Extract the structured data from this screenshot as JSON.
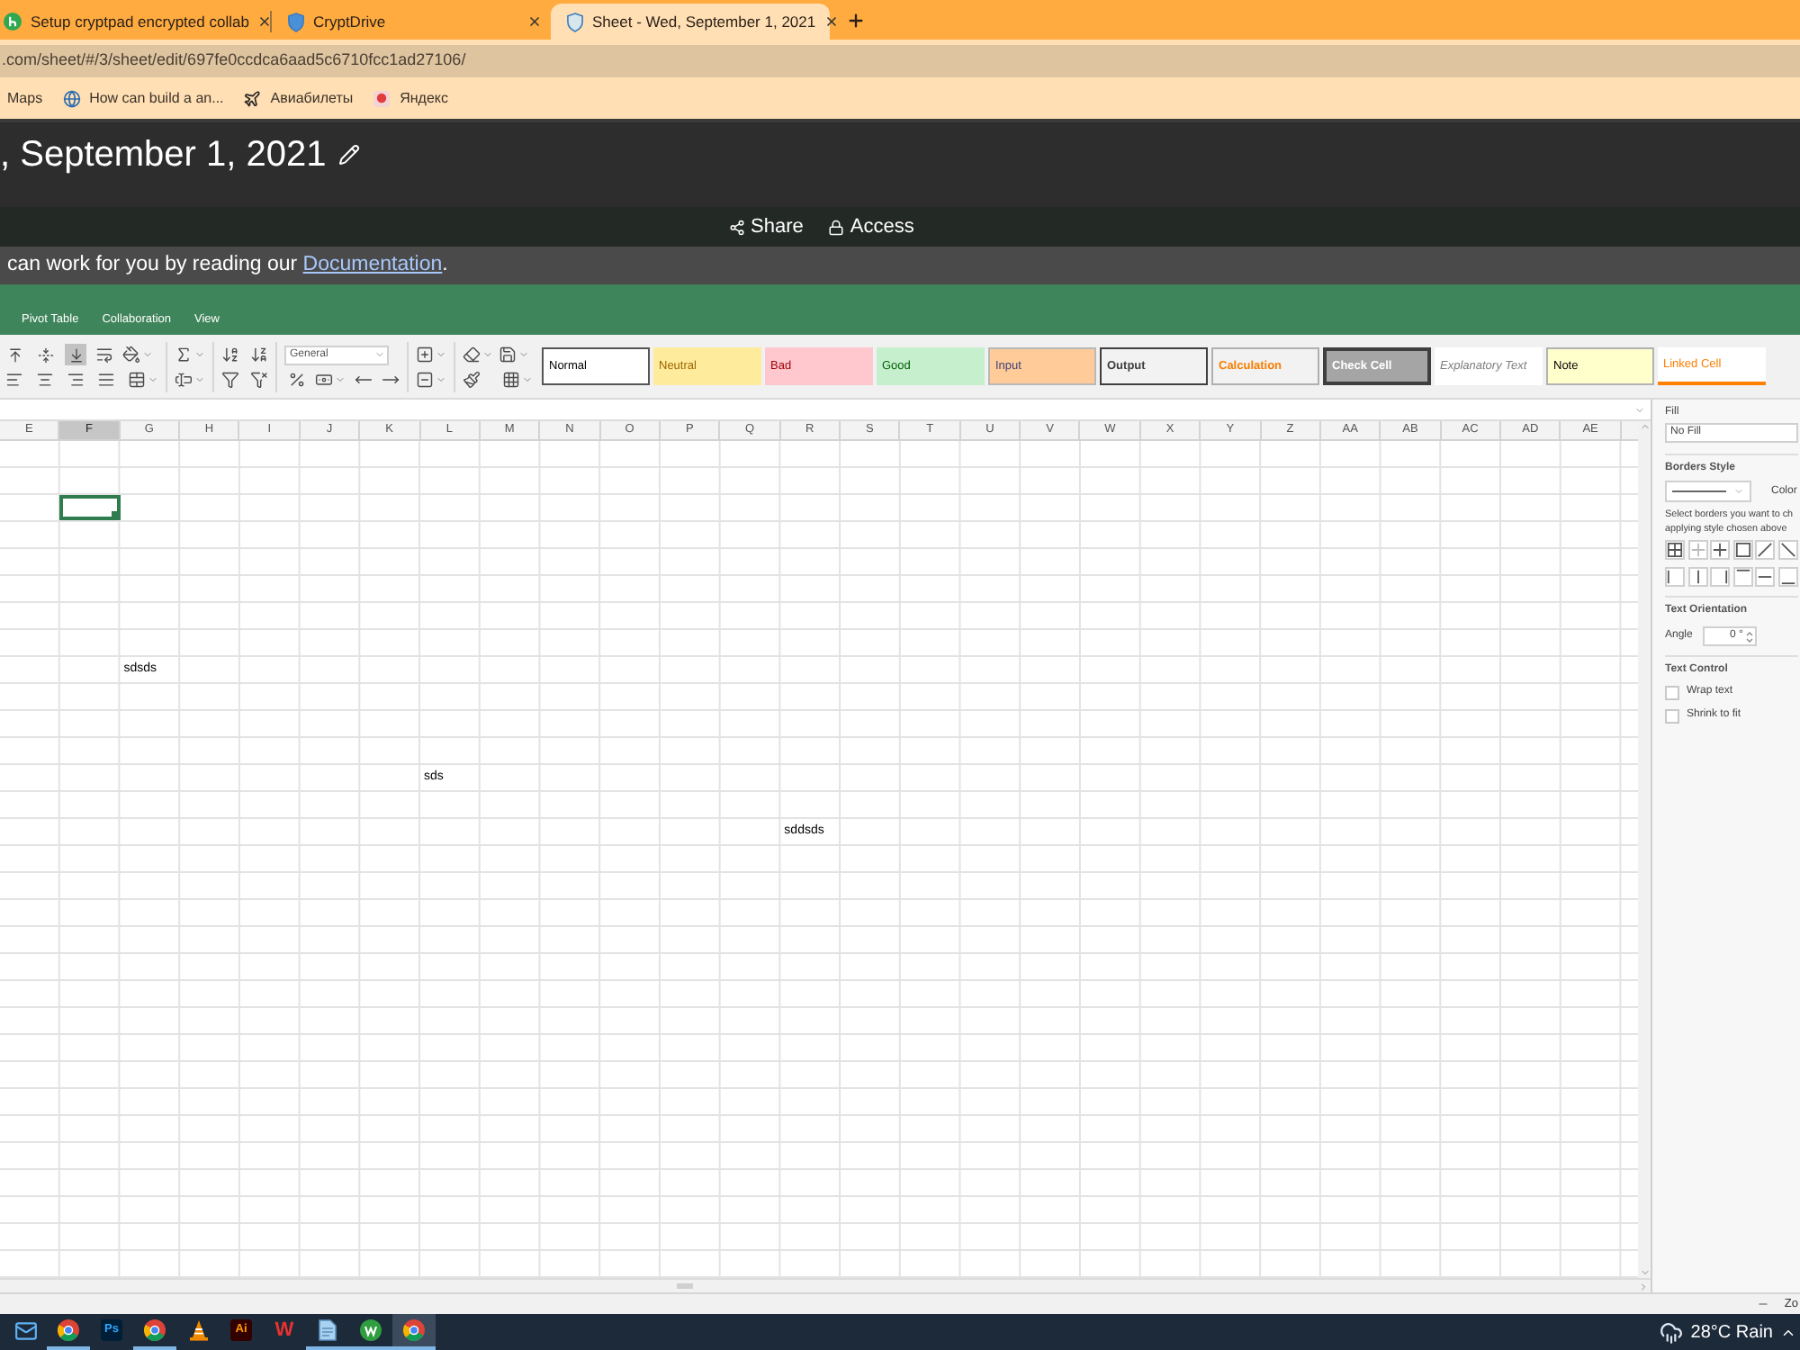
{
  "browser": {
    "tabs": [
      {
        "title": "Setup cryptpad encrypted collab",
        "selected": false
      },
      {
        "title": "CryptDrive",
        "selected": false
      },
      {
        "title": "Sheet - Wed, September 1, 2021",
        "selected": true
      }
    ],
    "address": ".com/sheet/#/3/sheet/edit/697fe0ccdca6aad5c6710fcc1ad27106/",
    "bookmarks": [
      {
        "label": "Maps"
      },
      {
        "label": "How can build a an..."
      },
      {
        "label": "Авиабилеты"
      },
      {
        "label": "Яндекс"
      }
    ]
  },
  "document": {
    "title": ", September 1, 2021",
    "share": "Share",
    "access": "Access",
    "notice": "can work for you by reading our",
    "notice_link": "Documentation",
    "notice_end": "."
  },
  "menu": [
    "Pivot Table",
    "Collaboration",
    "View"
  ],
  "toolbar": {
    "vertical_align": [
      {
        "selected": false
      },
      {
        "selected": false
      },
      {
        "selected": true
      }
    ],
    "number_format": "General"
  },
  "cell_styles": [
    {
      "label": "Normal",
      "kind": "normal"
    },
    {
      "label": "Neutral",
      "kind": "neutral"
    },
    {
      "label": "Bad",
      "kind": "bad"
    },
    {
      "label": "Good",
      "kind": "good"
    },
    {
      "label": "Input",
      "kind": "input"
    },
    {
      "label": "Output",
      "kind": "output"
    },
    {
      "label": "Calculation",
      "kind": "calculation"
    },
    {
      "label": "Check Cell",
      "kind": "check"
    },
    {
      "label": "Explanatory Text",
      "kind": "explanatory"
    },
    {
      "label": "Note",
      "kind": "note"
    },
    {
      "label": "Linked Cell",
      "kind": "linked"
    }
  ],
  "sheet": {
    "columns": [
      {
        "label": "E",
        "selected": false
      },
      {
        "label": "F",
        "selected": true
      },
      {
        "label": "G",
        "selected": false
      },
      {
        "label": "H",
        "selected": false
      },
      {
        "label": "I",
        "selected": false
      },
      {
        "label": "J",
        "selected": false
      },
      {
        "label": "K",
        "selected": false
      },
      {
        "label": "L",
        "selected": false
      },
      {
        "label": "M",
        "selected": false
      },
      {
        "label": "N",
        "selected": false
      },
      {
        "label": "O",
        "selected": false
      },
      {
        "label": "P",
        "selected": false
      },
      {
        "label": "Q",
        "selected": false
      },
      {
        "label": "R",
        "selected": false
      },
      {
        "label": "S",
        "selected": false
      },
      {
        "label": "T",
        "selected": false
      },
      {
        "label": "U",
        "selected": false
      },
      {
        "label": "V",
        "selected": false
      },
      {
        "label": "W",
        "selected": false
      },
      {
        "label": "X",
        "selected": false
      },
      {
        "label": "Y",
        "selected": false
      },
      {
        "label": "Z",
        "selected": false
      },
      {
        "label": "AA",
        "selected": false
      },
      {
        "label": "AB",
        "selected": false
      },
      {
        "label": "AC",
        "selected": false
      },
      {
        "label": "AD",
        "selected": false
      },
      {
        "label": "AE",
        "selected": false
      }
    ],
    "rows": [
      {
        "selected": false
      },
      {
        "selected": false
      },
      {
        "selected": true
      },
      {
        "selected": false
      },
      {
        "selected": false
      },
      {
        "selected": false
      },
      {
        "selected": false
      },
      {
        "selected": false
      },
      {
        "selected": false,
        "cells": {
          "G": "sdsds"
        }
      },
      {
        "selected": false
      },
      {
        "selected": false
      },
      {
        "selected": false
      },
      {
        "selected": false,
        "cells": {
          "L": "sds"
        }
      },
      {
        "selected": false
      },
      {
        "selected": false,
        "cells": {
          "R": "sddsds"
        }
      },
      {
        "selected": false
      },
      {
        "selected": false
      },
      {
        "selected": false
      },
      {
        "selected": false
      },
      {
        "selected": false
      },
      {
        "selected": false
      },
      {
        "selected": false
      },
      {
        "selected": false
      },
      {
        "selected": false
      },
      {
        "selected": false
      },
      {
        "selected": false
      },
      {
        "selected": false
      },
      {
        "selected": false
      },
      {
        "selected": false
      },
      {
        "selected": false
      },
      {
        "selected": false
      }
    ]
  },
  "format_panel": {
    "fill_label": "Fill",
    "fill_value": "No Fill",
    "borders_heading": "Borders Style",
    "color_label": "Color",
    "borders_hint": [
      "Select borders you want to ch",
      "applying style chosen above"
    ],
    "orientation_heading": "Text Orientation",
    "angle_label": "Angle",
    "angle_value": "0 °",
    "control_heading": "Text Control",
    "options": [
      {
        "label": "Wrap text",
        "checked": false
      },
      {
        "label": "Shrink to fit",
        "checked": false
      }
    ]
  },
  "status_bar": {
    "zoom_label": "Zo"
  },
  "taskbar": {
    "apps": [
      {
        "running": false,
        "selected": false
      },
      {
        "running": true,
        "selected": false
      },
      {
        "label": "Ps",
        "running": false,
        "selected": false
      },
      {
        "running": true,
        "selected": false
      },
      {
        "running": false,
        "selected": false
      },
      {
        "label": "Ai",
        "running": false,
        "selected": false
      },
      {
        "label": "W",
        "running": false,
        "selected": false
      },
      {
        "running": true,
        "selected": false
      },
      {
        "running": true,
        "selected": false
      },
      {
        "running": true,
        "selected": true
      }
    ],
    "weather": "28°C Rain"
  }
}
